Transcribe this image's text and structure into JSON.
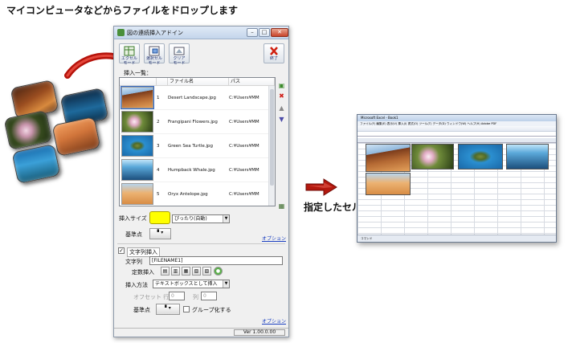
{
  "captions": {
    "top": "マイコンピュータなどからファイルをドロップします",
    "right": "指定したセルに合わせて連続挿入できます"
  },
  "addin": {
    "title": "図の連続挿入アドイン",
    "window_buttons": {
      "minimize": "–",
      "maximize": "□",
      "close": "✕"
    },
    "toolbar": {
      "excel_label": "エクセル\nモード",
      "select_label": "選択セル\nモード",
      "clear_label": "クリア\nモード",
      "exit_label": "終了"
    },
    "list_label": "挿入一覧：",
    "columns": [
      "",
      "",
      "ファイル名",
      "パス"
    ],
    "files": [
      {
        "no": "1",
        "name": "Desert Landscape.jpg",
        "path": "C:¥Users¥MM"
      },
      {
        "no": "2",
        "name": "Frangipani Flowers.jpg",
        "path": "C:¥Users¥MM"
      },
      {
        "no": "3",
        "name": "Green Sea Turtle.jpg",
        "path": "C:¥Users¥MM"
      },
      {
        "no": "4",
        "name": "Humpback Whale.jpg",
        "path": "C:¥Users¥MM"
      },
      {
        "no": "5",
        "name": "Oryx Antelope.jpg",
        "path": "C:¥Users¥MM"
      }
    ],
    "insert_size_label": "挿入サイズ",
    "insert_size_value": "ぴったり(自動)",
    "base_point_label": "基準点",
    "options_link": "オプション",
    "text_insert_label": "文字列挿入",
    "text_label": "文字列",
    "text_value": "[FILENAME1]",
    "preset_label": "定数挿入",
    "insert_method_label": "挿入方法",
    "insert_method_value": "テキストボックスとして挿入",
    "offset_row_label": "オフセット 行",
    "offset_col_label": "列",
    "offset_row_value": "0",
    "offset_col_value": "0",
    "base_point_label_2": "基準点",
    "group_label": "グループ化する",
    "options_link_2": "オプション",
    "version": "Ver 1.00.0.00"
  },
  "excel": {
    "title": "Microsoft Excel - Book1",
    "menu": "ファイル(F)  編集(E)  表示(V)  挿入(I)  書式(O)  ツール(T)  データ(D)  ウィンドウ(W)  ヘルプ(H)  Adobe PDF",
    "status": "コマンド"
  }
}
